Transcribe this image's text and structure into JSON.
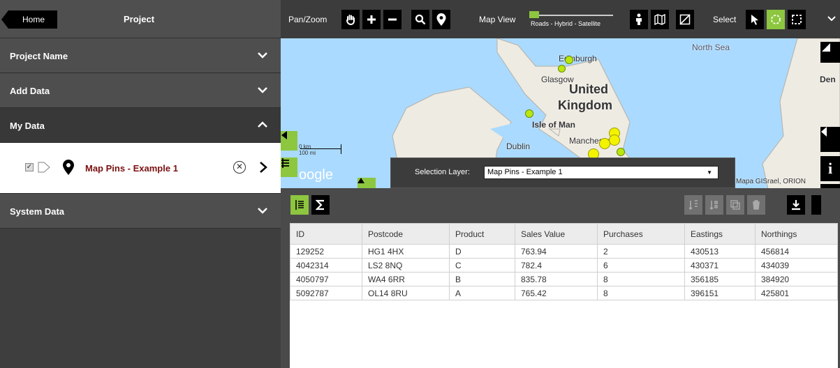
{
  "sidebar": {
    "home_label": "Home",
    "title": "Project",
    "sections": [
      {
        "label": "Project Name"
      },
      {
        "label": "Add Data"
      },
      {
        "label": "My Data"
      },
      {
        "label": "System Data"
      }
    ],
    "layer": {
      "name": "Map Pins - Example 1",
      "close_glyph": "✕"
    }
  },
  "toolbar": {
    "pan_zoom_label": "Pan/Zoom",
    "map_view_label": "Map View",
    "map_view_options": "Roads - Hybrid - Satellite",
    "select_label": "Select",
    "icons": [
      "hand-icon",
      "zoom-in-icon",
      "zoom-out-icon",
      "search-icon",
      "pin-icon",
      "street-view-icon",
      "map-fold-icon",
      "map-off-icon",
      "cursor-icon",
      "circle-select-icon",
      "rect-select-icon",
      "chevron-down-icon"
    ]
  },
  "map": {
    "labels": {
      "north_sea": "North Sea",
      "edinburgh": "Edinburgh",
      "glasgow": "Glasgow",
      "united": "United",
      "kingdom": "Kingdom",
      "isle_of_man": "Isle of Man",
      "dublin": "Dublin",
      "manchester": "Manchester",
      "denmark": "Den",
      "attribution": "Mapa GISrael, ORION",
      "google": "oogle",
      "scale_km": "0 km",
      "scale_mi": "100 mi"
    }
  },
  "selection": {
    "label": "Selection Layer:",
    "value": "Map Pins - Example 1"
  },
  "table": {
    "columns": [
      "ID",
      "Postcode",
      "Product",
      "Sales Value",
      "Purchases",
      "Eastings",
      "Northings"
    ],
    "rows": [
      [
        "129252",
        "HG1 4HX",
        "D",
        "763.94",
        "2",
        "430513",
        "456814"
      ],
      [
        "4042314",
        "LS2 8NQ",
        "C",
        "782.4",
        "6",
        "430371",
        "434039"
      ],
      [
        "4050797",
        "WA4 6RR",
        "B",
        "835.78",
        "8",
        "356185",
        "384920"
      ],
      [
        "5092787",
        "OL14 8RU",
        "A",
        "765.42",
        "8",
        "396151",
        "425801"
      ]
    ]
  },
  "colors": {
    "accent": "#8dc63f",
    "layer_name": "#7a1010",
    "sidebar_bg": "#3e3e3e"
  }
}
